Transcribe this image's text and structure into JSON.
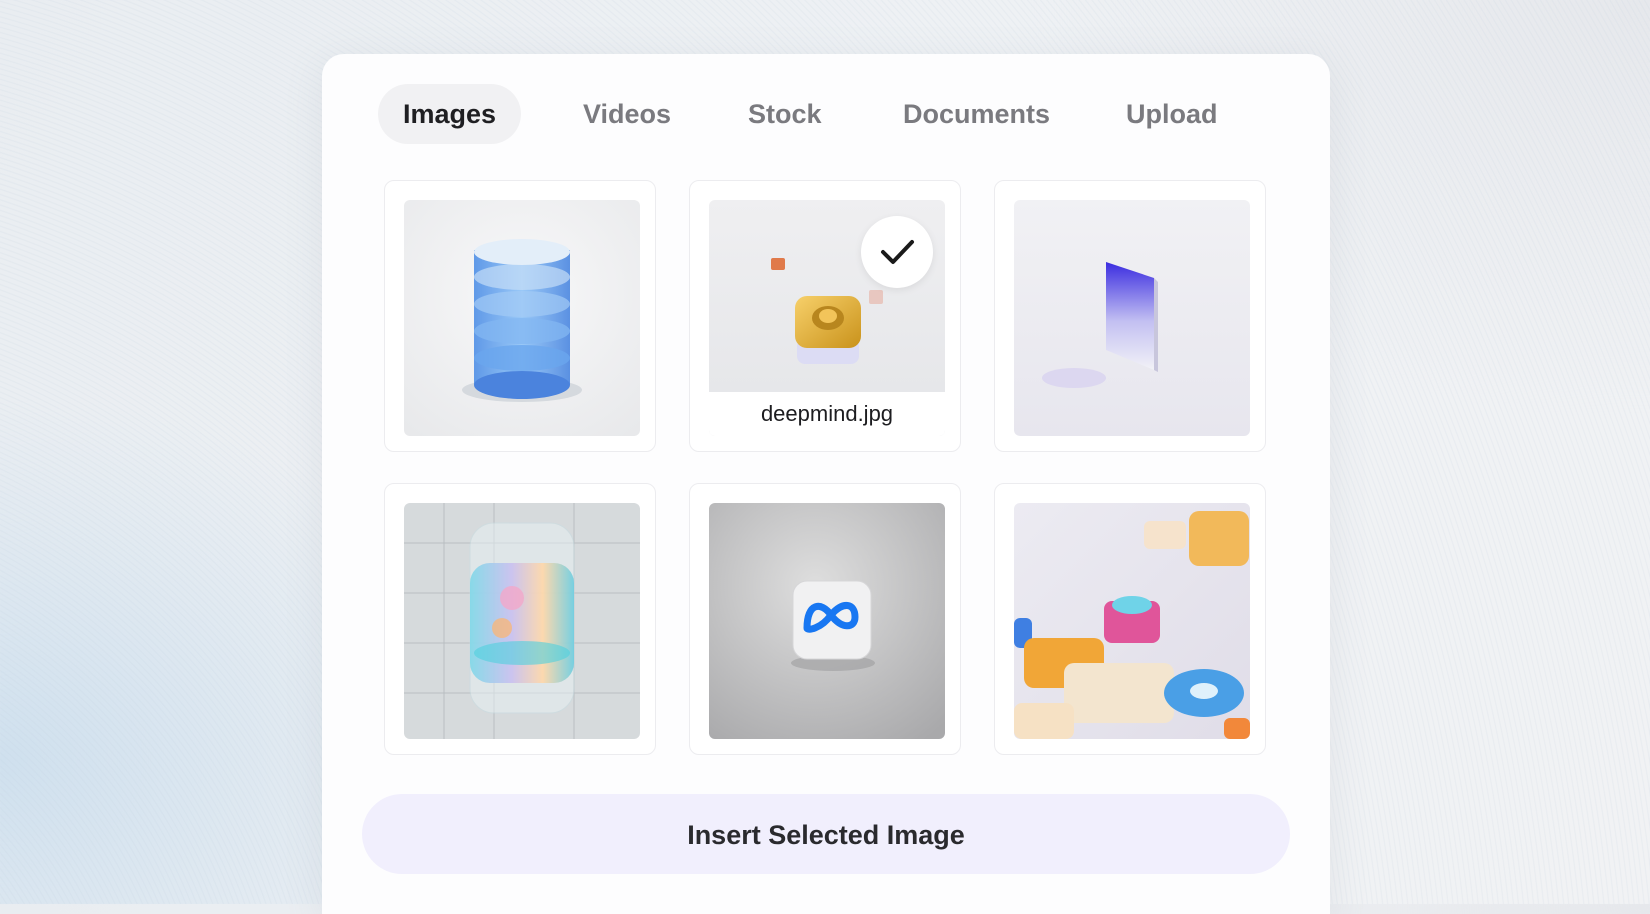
{
  "tabs": [
    {
      "label": "Images",
      "active": true
    },
    {
      "label": "Videos",
      "active": false
    },
    {
      "label": "Stock",
      "active": false
    },
    {
      "label": "Documents",
      "active": false
    },
    {
      "label": "Upload",
      "active": false
    }
  ],
  "images": [
    {
      "subject": "blue stacked cylinder",
      "selected": false
    },
    {
      "subject": "gold rounded cube",
      "caption": "deepmind.jpg",
      "selected": true
    },
    {
      "subject": "purple glass slab",
      "selected": false
    },
    {
      "subject": "glass cylinder on grid",
      "selected": false
    },
    {
      "subject": "meta logo tile",
      "selected": false
    },
    {
      "subject": "colorful 3d shapes",
      "selected": false
    }
  ],
  "selection_icon": "checkmark-icon",
  "insert_button": {
    "label": "Insert Selected Image"
  },
  "colors": {
    "active_tab_bg": "#f1f1f3",
    "button_bg": "#f1effd",
    "meta_blue": "#1877f2"
  }
}
